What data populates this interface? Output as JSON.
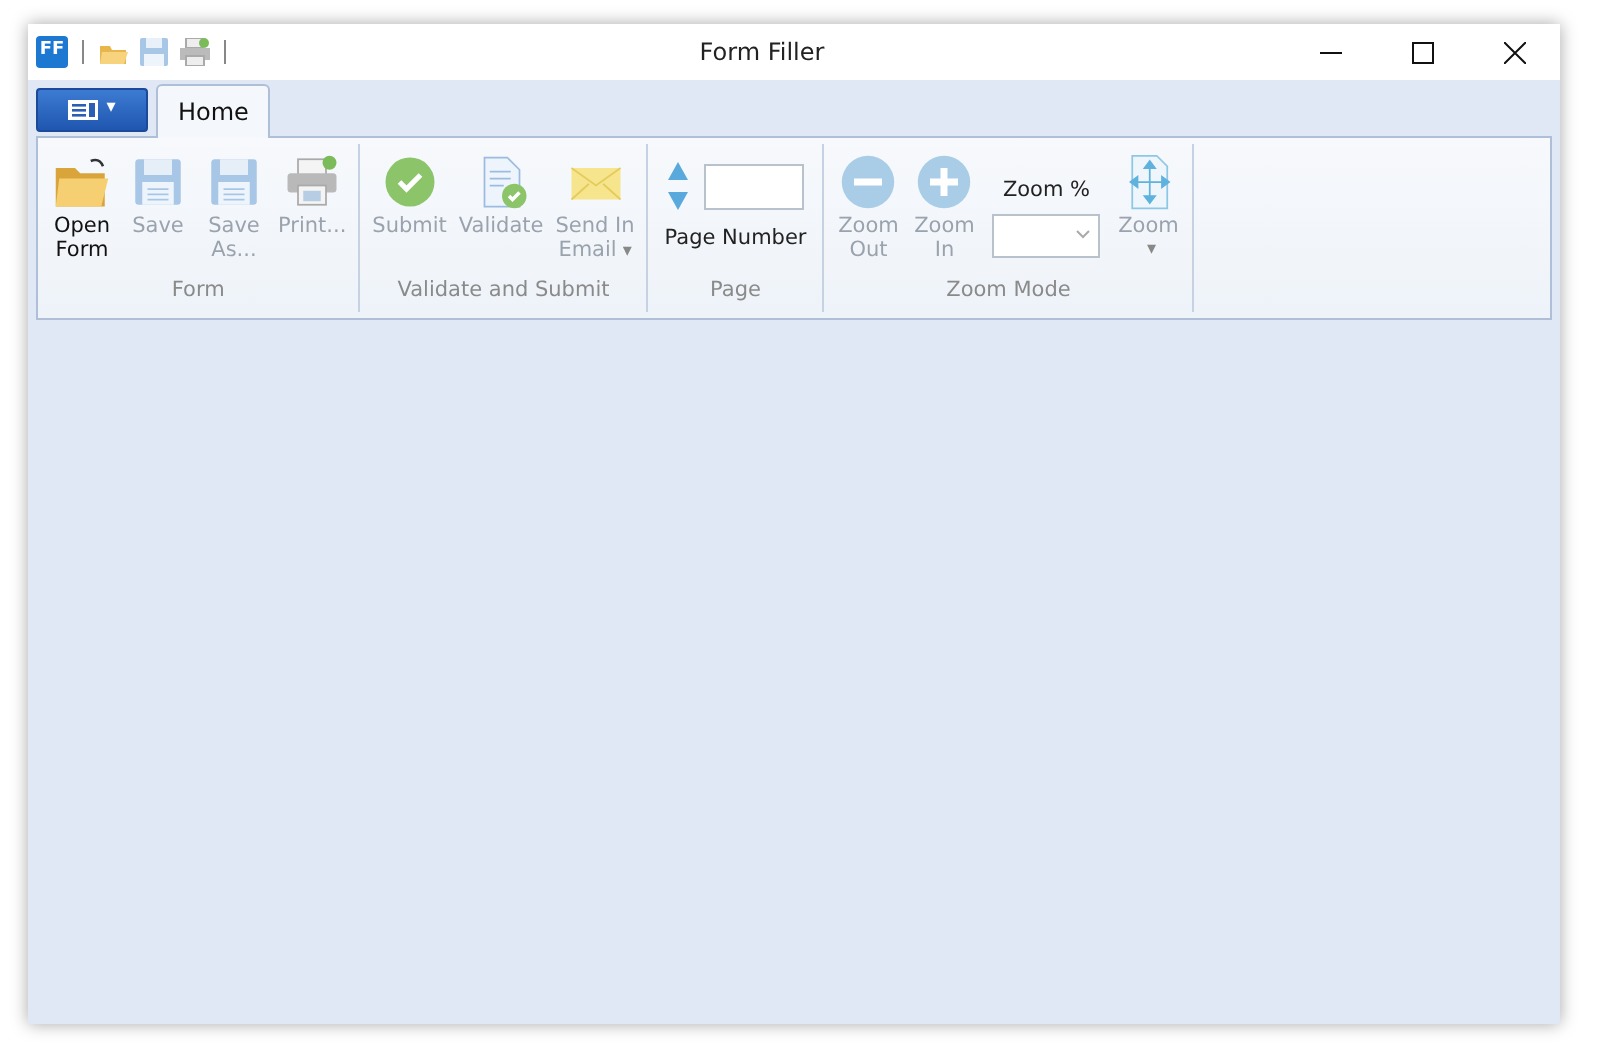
{
  "window": {
    "title": "Form Filler",
    "app_icon": "FF"
  },
  "app_menu": {
    "caret": "▾"
  },
  "tabs": [
    {
      "label": "Home",
      "selected": true
    }
  ],
  "groups": [
    {
      "label": "Form",
      "items": [
        {
          "kind": "button",
          "label": "Open\nForm",
          "disabled": false
        },
        {
          "kind": "button",
          "label": "Save",
          "disabled": true
        },
        {
          "kind": "button",
          "label": "Save\nAs...",
          "disabled": true
        },
        {
          "kind": "button",
          "label": "Print...",
          "disabled": true
        }
      ]
    },
    {
      "label": "Validate and Submit",
      "items": [
        {
          "kind": "button",
          "label": "Submit",
          "disabled": true
        },
        {
          "kind": "button",
          "label": "Validate",
          "disabled": true
        },
        {
          "kind": "button",
          "label": "Send In\nEmail",
          "disabled": true,
          "caret": "▾"
        }
      ]
    },
    {
      "label": "Page",
      "items": [
        {
          "kind": "spinner",
          "label": "Page Number",
          "disabled": false
        }
      ]
    },
    {
      "label": "Zoom Mode",
      "items": [
        {
          "kind": "button",
          "label": "Zoom\nOut",
          "disabled": true
        },
        {
          "kind": "button",
          "label": "Zoom\nIn",
          "disabled": true
        },
        {
          "kind": "combo",
          "label": "Zoom %",
          "disabled": false
        },
        {
          "kind": "button",
          "label": "Zoom",
          "disabled": true,
          "caret": "▾"
        }
      ]
    }
  ]
}
